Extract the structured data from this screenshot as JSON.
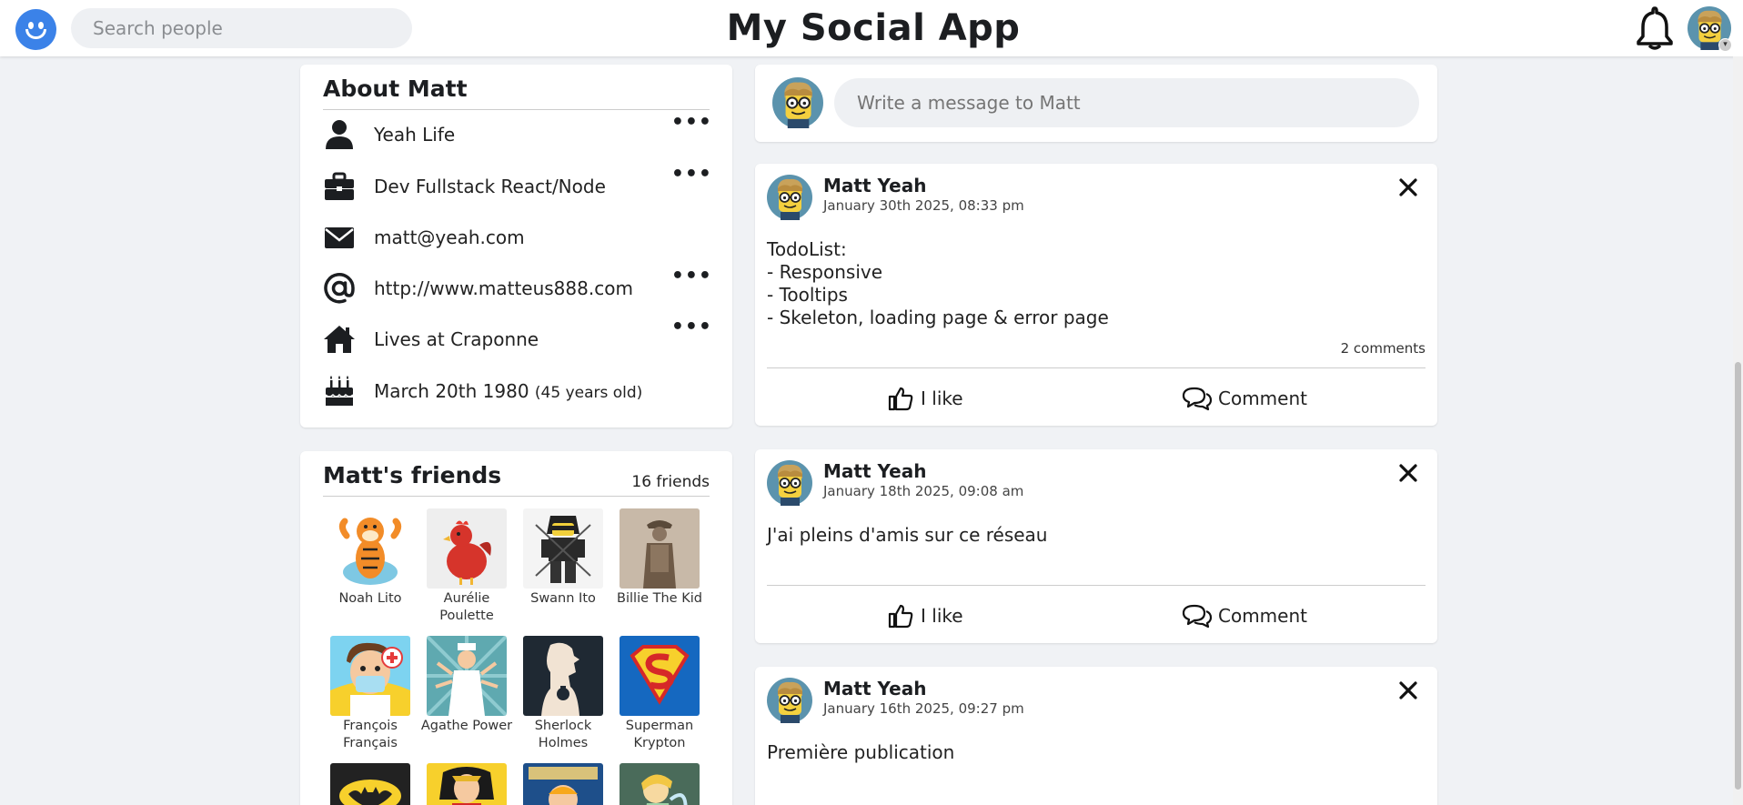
{
  "header": {
    "title": "My Social App",
    "search_placeholder": "Search people",
    "brand_color": "#3b82e8"
  },
  "about": {
    "title": "About Matt",
    "items": [
      {
        "icon": "user-icon",
        "text": "Yeah Life"
      },
      {
        "icon": "briefcase-icon",
        "text": "Dev Fullstack React/Node"
      },
      {
        "icon": "envelope-icon",
        "text": "matt@yeah.com"
      },
      {
        "icon": "at-icon",
        "text": "http://www.matteus888.com"
      },
      {
        "icon": "home-icon",
        "text": "Lives at Craponne"
      },
      {
        "icon": "birthday-cake-icon",
        "text": "March 20th 1980",
        "extra": "(45 years old)"
      }
    ]
  },
  "friends": {
    "title": "Matt's friends",
    "count": "16 friends",
    "list": [
      {
        "name": "Noah Lito"
      },
      {
        "name": "Aurélie Poulette"
      },
      {
        "name": "Swann Ito"
      },
      {
        "name": "Billie The Kid"
      },
      {
        "name": "François Français"
      },
      {
        "name": "Agathe Power"
      },
      {
        "name": "Sherlock Holmes"
      },
      {
        "name": "Superman Krypton"
      }
    ]
  },
  "composer": {
    "placeholder": "Write a message to Matt"
  },
  "posts": [
    {
      "author": "Matt Yeah",
      "date": "January 30th 2025, 08:33 pm",
      "body": "TodoList:\n- Responsive\n- Tooltips\n- Skeleton, loading page & error page",
      "comments": "2 comments",
      "like_label": "I like",
      "comment_label": "Comment"
    },
    {
      "author": "Matt Yeah",
      "date": "January 18th 2025, 09:08 am",
      "body": "J'ai pleins d'amis sur ce réseau",
      "like_label": "I like",
      "comment_label": "Comment"
    },
    {
      "author": "Matt Yeah",
      "date": "January 16th 2025, 09:27 pm",
      "body": "Première publication"
    }
  ]
}
